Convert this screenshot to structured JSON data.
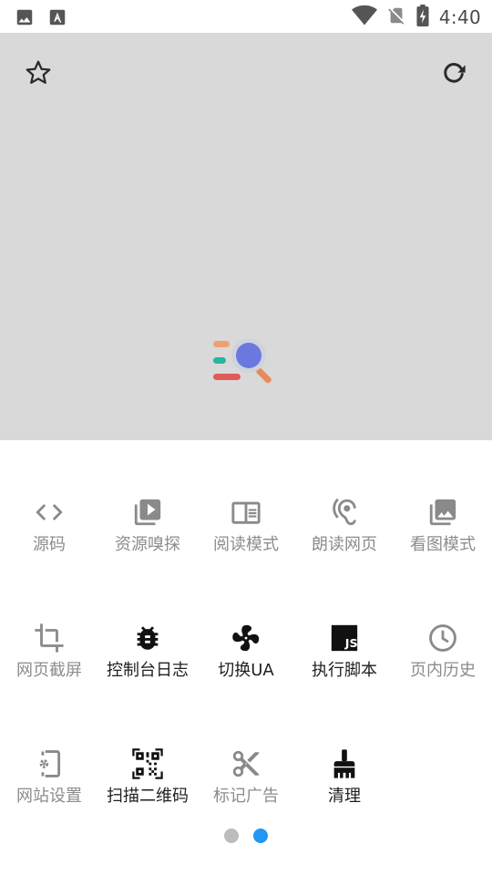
{
  "status_bar": {
    "time": "4:40",
    "left_icons": [
      "image-notification-icon",
      "font-notification-icon"
    ],
    "right_icons": [
      "wifi-icon",
      "no-sim-icon",
      "battery-charging-icon"
    ]
  },
  "preview": {
    "background": "#d9d9d9",
    "favorite_icon": "star-outline-icon",
    "refresh_icon": "refresh-icon",
    "logo_icon": "app-logo-magnifier-icon"
  },
  "menu": {
    "rows": [
      [
        {
          "label": "源码",
          "icon": "code-brackets-icon",
          "active": false
        },
        {
          "label": "资源嗅探",
          "icon": "video-library-icon",
          "active": false
        },
        {
          "label": "阅读模式",
          "icon": "reader-mode-icon",
          "active": false
        },
        {
          "label": "朗读网页",
          "icon": "hearing-ear-icon",
          "active": false
        },
        {
          "label": "看图模式",
          "icon": "photo-library-icon",
          "active": false
        }
      ],
      [
        {
          "label": "网页截屏",
          "icon": "crop-icon",
          "active": false
        },
        {
          "label": "控制台日志",
          "icon": "bug-icon",
          "active": true
        },
        {
          "label": "切换UA",
          "icon": "fan-icon",
          "active": true
        },
        {
          "label": "执行脚本",
          "icon": "js-script-icon",
          "active": true
        },
        {
          "label": "页内历史",
          "icon": "clock-icon",
          "active": false
        }
      ],
      [
        {
          "label": "网站设置",
          "icon": "site-settings-icon",
          "active": false
        },
        {
          "label": "扫描二维码",
          "icon": "qr-code-icon",
          "active": true
        },
        {
          "label": "标记广告",
          "icon": "scissors-icon",
          "active": false
        },
        {
          "label": "清理",
          "icon": "broom-icon",
          "active": true
        }
      ]
    ]
  },
  "pager": {
    "count": 2,
    "current": 1,
    "inactive_color": "#bdbdbd",
    "active_color": "#2196f3"
  },
  "colors": {
    "muted_label": "#8c8c8c",
    "active_label": "#1f1f1f",
    "muted_icon": "#8a8a8a",
    "active_icon": "#111111"
  }
}
